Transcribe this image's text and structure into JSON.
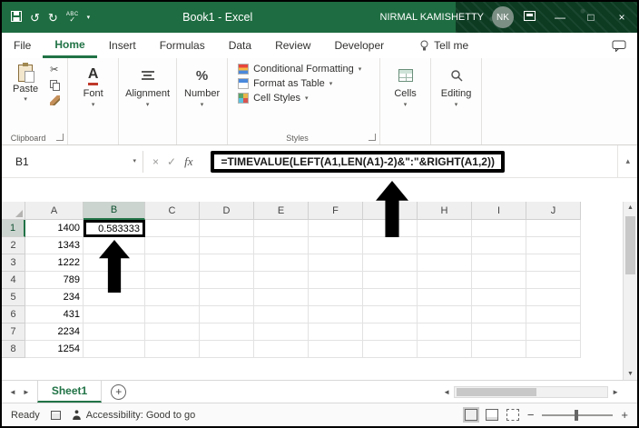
{
  "window": {
    "title": "Book1 - Excel",
    "user_name": "NIRMAL KAMISHETTY",
    "avatar": "NK"
  },
  "tabs": {
    "items": [
      "File",
      "Home",
      "Insert",
      "Formulas",
      "Data",
      "Review",
      "Developer"
    ],
    "active": "Home",
    "tell_me": "Tell me"
  },
  "ribbon": {
    "clipboard": {
      "paste": "Paste",
      "label": "Clipboard"
    },
    "font": {
      "label": "Font"
    },
    "alignment": {
      "label": "Alignment"
    },
    "number": {
      "label": "Number"
    },
    "styles": {
      "label": "Styles",
      "items": [
        "Conditional Formatting",
        "Format as Table",
        "Cell Styles"
      ]
    },
    "cells": {
      "label": "Cells"
    },
    "editing": {
      "label": "Editing"
    }
  },
  "formula_bar": {
    "name_box": "B1",
    "formula": "=TIMEVALUE(LEFT(A1,LEN(A1)-2)&\":\"&RIGHT(A1,2))"
  },
  "grid": {
    "columns": [
      "A",
      "B",
      "C",
      "D",
      "E",
      "F",
      "G",
      "H",
      "I",
      "J"
    ],
    "row_count": 8,
    "selected_cell": "B1",
    "column_a_values": [
      "1400",
      "1343",
      "1222",
      "789",
      "234",
      "431",
      "2234",
      "1254"
    ],
    "b1_value": "0.583333"
  },
  "sheet": {
    "active_tab": "Sheet1"
  },
  "status": {
    "mode": "Ready",
    "accessibility": "Accessibility: Good to go"
  },
  "colors": {
    "accent": "#217346",
    "titlebar": "#1e6c41"
  }
}
